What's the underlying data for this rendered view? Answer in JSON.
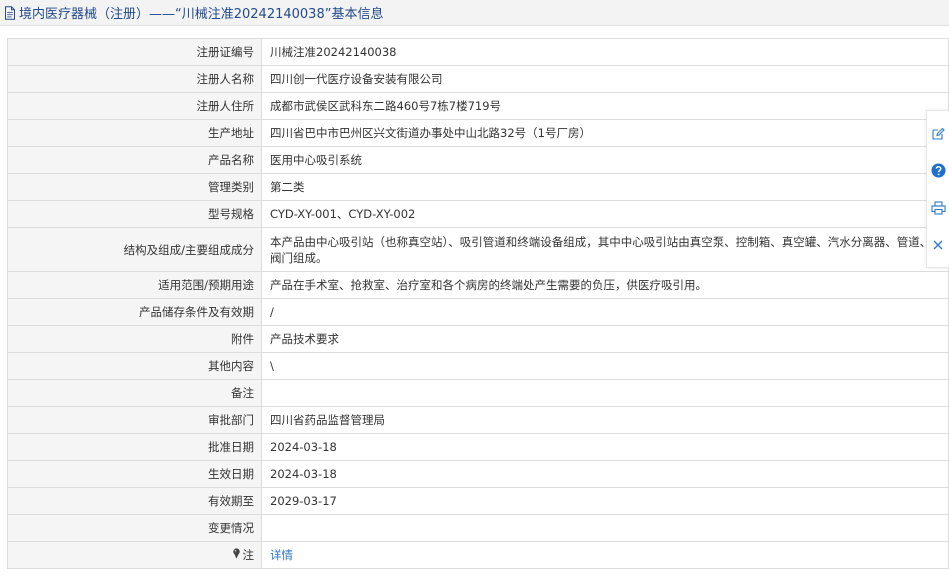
{
  "header": {
    "title": "境内医疗器械（注册）——“川械注准20242140038”基本信息",
    "icon": "document-icon"
  },
  "rows": [
    {
      "label": "注册证编号",
      "value": "川械注准20242140038"
    },
    {
      "label": "注册人名称",
      "value": "四川创一代医疗设备安装有限公司"
    },
    {
      "label": "注册人住所",
      "value": "成都市武侯区武科东二路460号7栋7楼719号"
    },
    {
      "label": "生产地址",
      "value": "四川省巴中市巴州区兴文街道办事处中山北路32号（1号厂房）"
    },
    {
      "label": "产品名称",
      "value": "医用中心吸引系统"
    },
    {
      "label": "管理类别",
      "value": "第二类"
    },
    {
      "label": "型号规格",
      "value": "CYD-XY-001、CYD-XY-002"
    },
    {
      "label": "结构及组成/主要组成成分",
      "value": "本产品由中心吸引站（也称真空站）、吸引管道和终端设备组成，其中中心吸引站由真空泵、控制箱、真空罐、汽水分离器、管道、阀门组成。"
    },
    {
      "label": "适用范围/预期用途",
      "value": "产品在手术室、抢救室、治疗室和各个病房的终端处产生需要的负压，供医疗吸引用。"
    },
    {
      "label": "产品储存条件及有效期",
      "value": "/"
    },
    {
      "label": "附件",
      "value": "产品技术要求"
    },
    {
      "label": "其他内容",
      "value": "\\"
    },
    {
      "label": "备注",
      "value": ""
    },
    {
      "label": "审批部门",
      "value": "四川省药品监督管理局"
    },
    {
      "label": "批准日期",
      "value": "2024-03-18"
    },
    {
      "label": "生效日期",
      "value": "2024-03-18"
    },
    {
      "label": "有效期至",
      "value": "2029-03-17"
    },
    {
      "label": "变更情况",
      "value": ""
    }
  ],
  "note_row": {
    "label": "注",
    "link": "详情",
    "icon": "pin-icon"
  },
  "side_toolbar": [
    {
      "icon": "edit-icon"
    },
    {
      "icon": "help-icon"
    },
    {
      "icon": "print-icon"
    },
    {
      "icon": "close-icon"
    }
  ],
  "colors": {
    "header_text": "#234a8c",
    "link": "#2d79c7",
    "label_bg": "#f5f5f5",
    "border": "#dcdcdc"
  }
}
